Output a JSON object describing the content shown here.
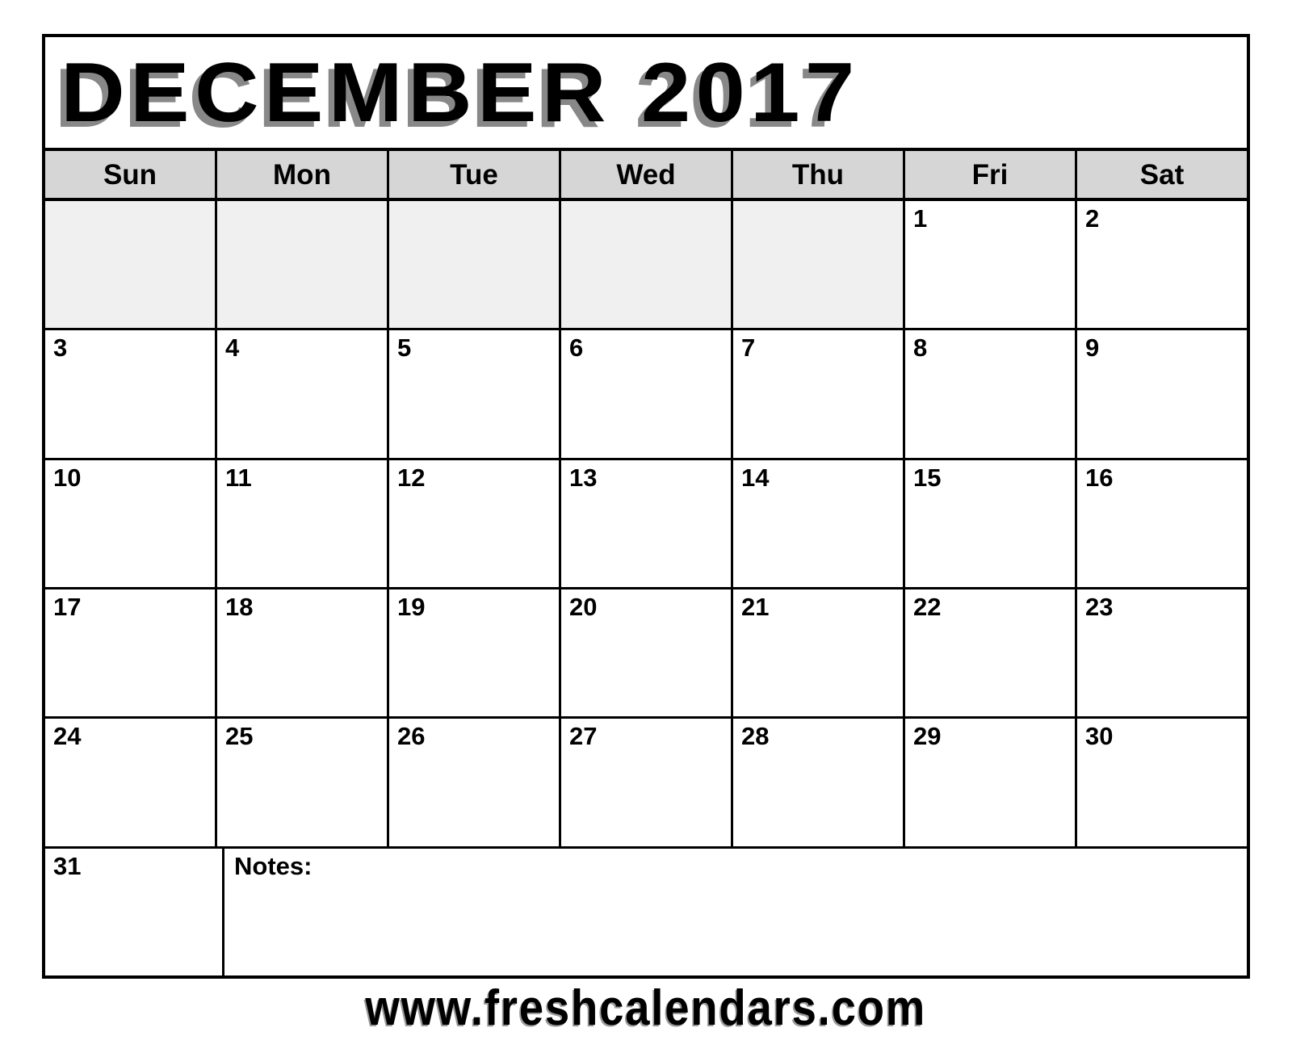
{
  "calendar": {
    "title": "DECEMBER 2017",
    "month": "DECEMBER",
    "year": "2017",
    "weekday_headers": [
      {
        "label": "Sun"
      },
      {
        "label": "Mon"
      },
      {
        "label": "Tue"
      },
      {
        "label": "Wed"
      },
      {
        "label": "Thu"
      },
      {
        "label": "Fri"
      },
      {
        "label": "Sat"
      }
    ],
    "weeks": [
      {
        "cells": [
          {
            "day": "",
            "blank": true
          },
          {
            "day": "",
            "blank": true
          },
          {
            "day": "",
            "blank": true
          },
          {
            "day": "",
            "blank": true
          },
          {
            "day": "",
            "blank": true
          },
          {
            "day": "1",
            "blank": false
          },
          {
            "day": "2",
            "blank": false
          }
        ]
      },
      {
        "cells": [
          {
            "day": "3",
            "blank": false
          },
          {
            "day": "4",
            "blank": false
          },
          {
            "day": "5",
            "blank": false
          },
          {
            "day": "6",
            "blank": false
          },
          {
            "day": "7",
            "blank": false
          },
          {
            "day": "8",
            "blank": false
          },
          {
            "day": "9",
            "blank": false
          }
        ]
      },
      {
        "cells": [
          {
            "day": "10",
            "blank": false
          },
          {
            "day": "11",
            "blank": false
          },
          {
            "day": "12",
            "blank": false
          },
          {
            "day": "13",
            "blank": false
          },
          {
            "day": "14",
            "blank": false
          },
          {
            "day": "15",
            "blank": false
          },
          {
            "day": "16",
            "blank": false
          }
        ]
      },
      {
        "cells": [
          {
            "day": "17",
            "blank": false
          },
          {
            "day": "18",
            "blank": false
          },
          {
            "day": "19",
            "blank": false
          },
          {
            "day": "20",
            "blank": false
          },
          {
            "day": "21",
            "blank": false
          },
          {
            "day": "22",
            "blank": false
          },
          {
            "day": "23",
            "blank": false
          }
        ]
      },
      {
        "cells": [
          {
            "day": "24",
            "blank": false
          },
          {
            "day": "25",
            "blank": false
          },
          {
            "day": "26",
            "blank": false
          },
          {
            "day": "27",
            "blank": false
          },
          {
            "day": "28",
            "blank": false
          },
          {
            "day": "29",
            "blank": false
          },
          {
            "day": "30",
            "blank": false
          }
        ]
      }
    ],
    "last_row": {
      "day": "31",
      "notes_label": "Notes:"
    }
  },
  "footer": {
    "url": "www.freshcalendars.com"
  },
  "colors": {
    "border": "#000000",
    "header_bg": "#d6d6d6",
    "blank_cell_bg": "#f0f0f0",
    "cell_bg": "#ffffff",
    "text": "#000000",
    "title_shadow": "#888888",
    "footer_shadow": "#9a9a9a"
  }
}
